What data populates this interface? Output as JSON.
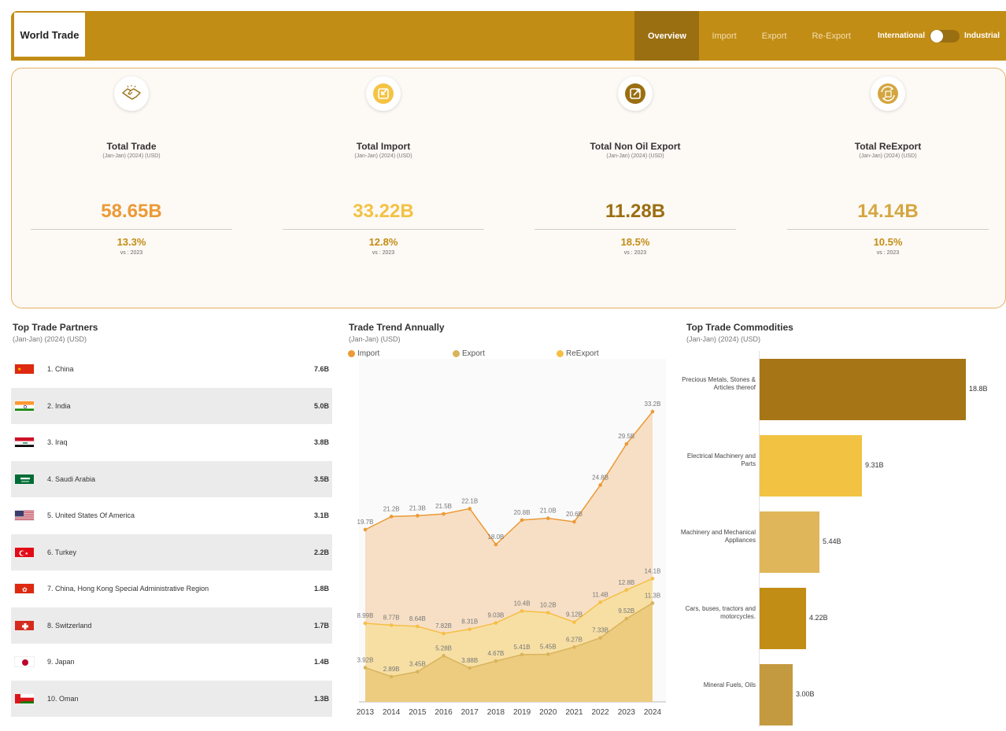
{
  "header": {
    "logo_text": "World Trade",
    "nav": [
      "Overview",
      "Import",
      "Export",
      "Re-Export"
    ],
    "toggle_left": "International",
    "toggle_right": "Industrial"
  },
  "kpis": [
    {
      "title": "Total Trade",
      "sub": "(Jan-Jan) (2024) (USD)",
      "value": "58.65B",
      "pct": "13.3%",
      "vs": "vs : 2023",
      "color": "#ec9a37",
      "icon": "handshake-icon"
    },
    {
      "title": "Total Import",
      "sub": "(Jan-Jan) (2024) (USD)",
      "value": "33.22B",
      "pct": "12.8%",
      "vs": "vs : 2023",
      "color": "#f2c243",
      "icon": "import-icon"
    },
    {
      "title": "Total Non Oil Export",
      "sub": "(Jan-Jan) (2024) (USD)",
      "value": "11.28B",
      "pct": "18.5%",
      "vs": "vs : 2023",
      "color": "#9a6f12",
      "icon": "export-icon"
    },
    {
      "title": "Total ReExport",
      "sub": "(Jan-Jan) (2024) (USD)",
      "value": "14.14B",
      "pct": "10.5%",
      "vs": "vs : 2023",
      "color": "#d4a640",
      "icon": "reexport-icon"
    }
  ],
  "partners": {
    "title": "Top Trade Partners",
    "sub": "(Jan-Jan) (2024) (USD)",
    "rows": [
      {
        "label": "1. China",
        "value": "7.6B",
        "flag": "china"
      },
      {
        "label": "2. India",
        "value": "5.0B",
        "flag": "india"
      },
      {
        "label": "3. Iraq",
        "value": "3.8B",
        "flag": "iraq"
      },
      {
        "label": "4. Saudi Arabia",
        "value": "3.5B",
        "flag": "saudi"
      },
      {
        "label": "5. United States Of America",
        "value": "3.1B",
        "flag": "usa"
      },
      {
        "label": "6. Turkey",
        "value": "2.2B",
        "flag": "turkey"
      },
      {
        "label": "7. China, Hong Kong Special Administrative Region",
        "value": "1.8B",
        "flag": "hongkong"
      },
      {
        "label": "8. Switzerland",
        "value": "1.7B",
        "flag": "swiss"
      },
      {
        "label": "9. Japan",
        "value": "1.4B",
        "flag": "japan"
      },
      {
        "label": "10. Oman",
        "value": "1.3B",
        "flag": "oman"
      }
    ]
  },
  "trend": {
    "title": "Trade Trend Annually",
    "sub": "(Jan-Jan) (USD)",
    "legend": [
      "Import",
      "Export",
      "ReExport"
    ]
  },
  "commodities": {
    "title": "Top Trade Commodities",
    "sub": "(Jan-Jan) (2024) (USD)"
  },
  "chart_data": [
    {
      "type": "area",
      "title": "Trade Trend Annually",
      "x": [
        "2013",
        "2014",
        "2015",
        "2016",
        "2017",
        "2018",
        "2019",
        "2020",
        "2021",
        "2022",
        "2023",
        "2024"
      ],
      "series": [
        {
          "name": "Import",
          "color": "#ec9a37",
          "values": [
            19.7,
            21.2,
            21.3,
            21.5,
            22.1,
            18.0,
            20.8,
            21.0,
            20.6,
            24.8,
            29.5,
            33.2
          ],
          "labels": [
            "19.7B",
            "21.2B",
            "21.3B",
            "21.5B",
            "22.1B",
            "18.0B",
            "20.8B",
            "21.0B",
            "20.6B",
            "24.8B",
            "29.5B",
            "33.2B"
          ]
        },
        {
          "name": "Export",
          "color": "#d9b45c",
          "values": [
            3.92,
            2.89,
            3.45,
            5.28,
            3.88,
            4.67,
            5.41,
            5.45,
            6.27,
            7.33,
            9.52,
            11.3
          ],
          "labels": [
            "3.92B",
            "2.89B",
            "3.45B",
            "5.28B",
            "3.88B",
            "4.67B",
            "5.41B",
            "5.45B",
            "6.27B",
            "7.33B",
            "9.52B",
            "11.3B"
          ]
        },
        {
          "name": "ReExport",
          "color": "#f5bf45",
          "values": [
            8.99,
            8.77,
            8.64,
            7.82,
            8.31,
            9.03,
            10.4,
            10.2,
            9.12,
            11.4,
            12.8,
            14.1
          ],
          "labels": [
            "8.99B",
            "8.77B",
            "8.64B",
            "7.82B",
            "8.31B",
            "9.03B",
            "10.4B",
            "10.2B",
            "9.12B",
            "11.4B",
            "12.8B",
            "14.1B"
          ]
        }
      ],
      "ylim": [
        0,
        36
      ]
    },
    {
      "type": "bar",
      "orientation": "horizontal",
      "title": "Top Trade Commodities",
      "categories": [
        "Precious Metals, Stones & Articles thereof",
        "Electrical Machinery and Parts",
        "Machinery and Mechanical Appliances",
        "Cars, buses, tractors and motorcycles.",
        "Mineral Fuels, Oils"
      ],
      "values": [
        18.8,
        9.31,
        5.44,
        4.22,
        3.0
      ],
      "labels": [
        "18.8B",
        "9.31B",
        "5.44B",
        "4.22B",
        "3.00B"
      ],
      "colors": [
        "#a67616",
        "#f2c243",
        "#e0b65a",
        "#c28d15",
        "#c49a40"
      ],
      "xlim": [
        0,
        18.8
      ]
    }
  ]
}
